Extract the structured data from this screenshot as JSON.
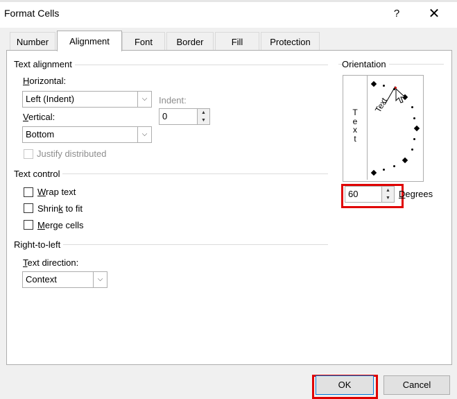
{
  "window": {
    "title": "Format Cells",
    "help_glyph": "?",
    "close_glyph": "✕"
  },
  "tabs": [
    {
      "label": "Number"
    },
    {
      "label": "Alignment"
    },
    {
      "label": "Font"
    },
    {
      "label": "Border"
    },
    {
      "label": "Fill"
    },
    {
      "label": "Protection"
    }
  ],
  "active_tab": "Alignment",
  "text_alignment": {
    "group_label": "Text alignment",
    "horizontal_label": "Horizontal:",
    "horizontal_value": "Left (Indent)",
    "indent_label": "Indent:",
    "indent_value": "0",
    "vertical_label": "Vertical:",
    "vertical_value": "Bottom",
    "justify_distributed_label": "Justify distributed",
    "justify_distributed_enabled": false
  },
  "text_control": {
    "group_label": "Text control",
    "wrap_text_label": "Wrap text",
    "shrink_to_fit_label": "Shrink to fit",
    "merge_cells_label": "Merge cells",
    "wrap_text_checked": false,
    "shrink_to_fit_checked": false,
    "merge_cells_checked": false
  },
  "right_to_left": {
    "group_label": "Right-to-left",
    "text_direction_label": "Text direction:",
    "text_direction_value": "Context"
  },
  "orientation": {
    "group_label": "Orientation",
    "vertical_text_letters": [
      "T",
      "e",
      "x",
      "t"
    ],
    "dial_text": "Text",
    "degrees_value": "60",
    "degrees_label": "Degrees",
    "degrees_highlighted": true
  },
  "footer": {
    "ok_label": "OK",
    "cancel_label": "Cancel",
    "ok_highlighted": true
  },
  "colors": {
    "highlight": "#e00000",
    "panel_border": "#adadad",
    "background": "#f0f0f0"
  },
  "icons": [
    "chevron-down-icon",
    "spin-up-icon",
    "spin-down-icon",
    "close-icon",
    "help-icon",
    "mouse-pointer-icon"
  ]
}
